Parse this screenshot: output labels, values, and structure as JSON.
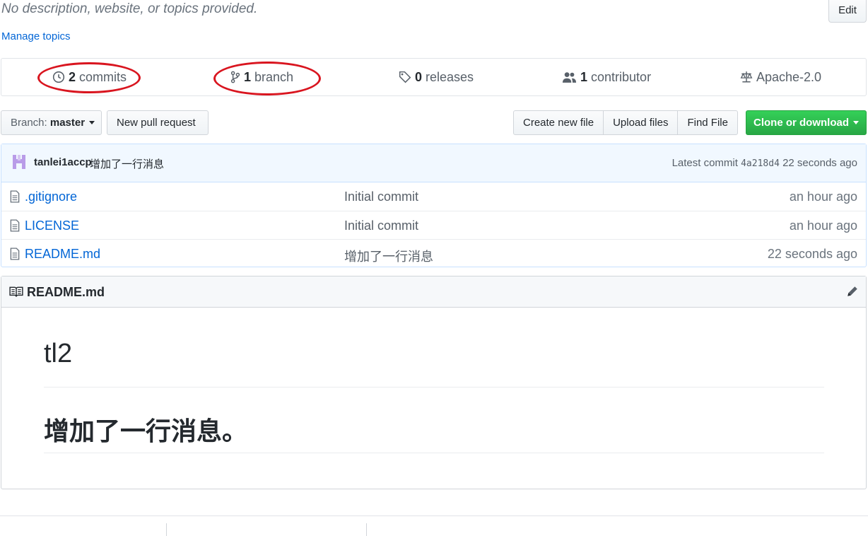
{
  "repo": {
    "description": "No description, website, or topics provided.",
    "edit_label": "Edit",
    "manage_topics": "Manage topics"
  },
  "summary": {
    "commits_count": "2",
    "commits_label": "commits",
    "branch_count": "1",
    "branch_label": "branch",
    "releases_count": "0",
    "releases_label": "releases",
    "contributor_count": "1",
    "contributor_label": "contributor",
    "license": "Apache-2.0",
    "highlight_color": "#d9151f"
  },
  "toolbar": {
    "branch_prefix": "Branch:",
    "branch_name": "master",
    "new_pull_request": "New pull request",
    "create_new_file": "Create new file",
    "upload_files": "Upload files",
    "find_file": "Find File",
    "clone_or_download": "Clone or download",
    "clone_color": "#28a745"
  },
  "latest_commit": {
    "author": "tanlei1accp",
    "message": "增加了一行消息",
    "prefix": "Latest commit",
    "sha": "4a218d4",
    "age": "22 seconds ago"
  },
  "files": [
    {
      "name": ".gitignore",
      "message": "Initial commit",
      "age": "an hour ago",
      "icon": "file-icon"
    },
    {
      "name": "LICENSE",
      "message": "Initial commit",
      "age": "an hour ago",
      "icon": "file-icon"
    },
    {
      "name": "README.md",
      "message": "增加了一行消息",
      "age": "22 seconds ago",
      "icon": "file-icon"
    }
  ],
  "readme": {
    "filename": "README.md",
    "heading1": "tl2",
    "heading2": "增加了一行消息。"
  }
}
